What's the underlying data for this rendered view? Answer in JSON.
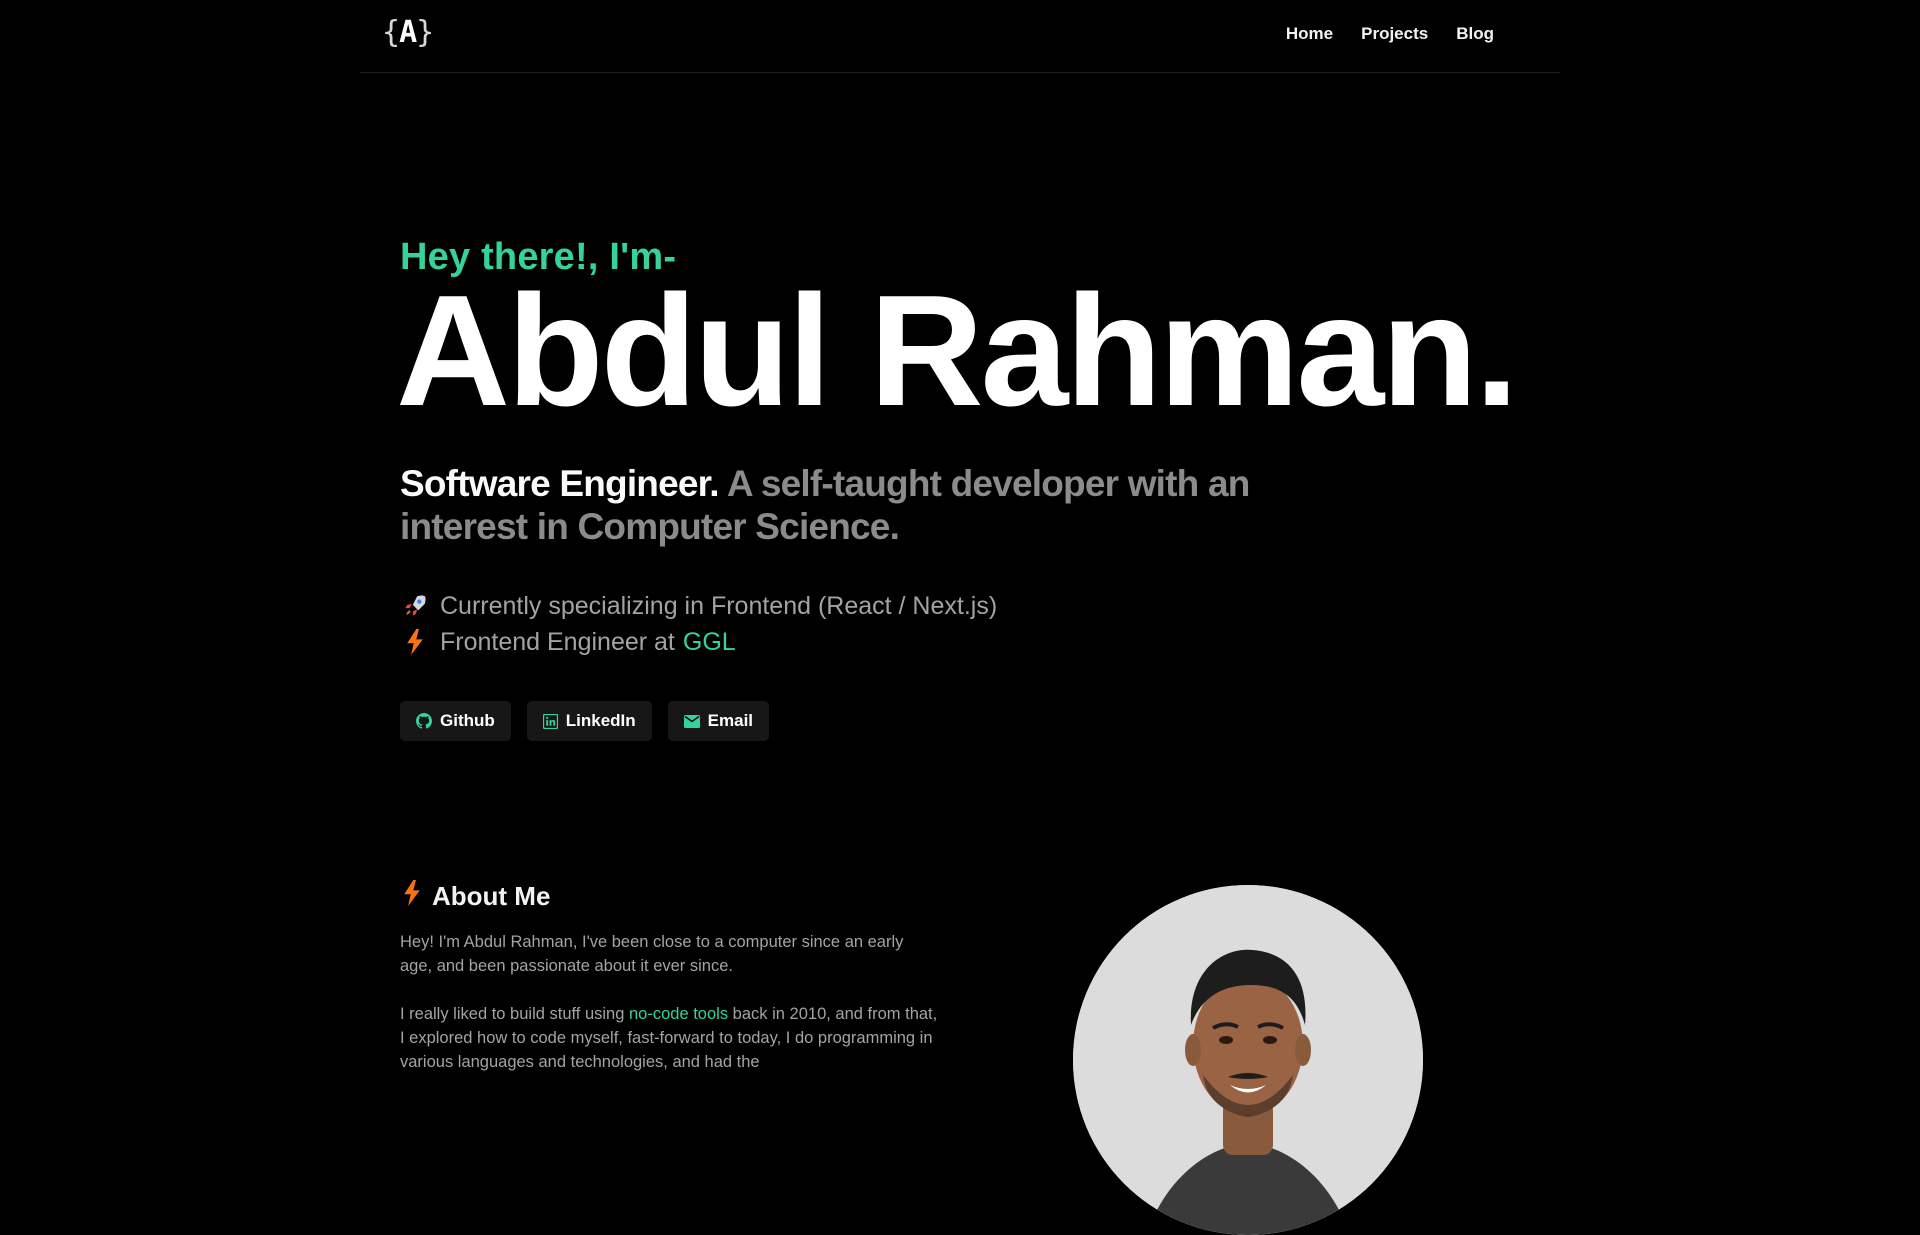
{
  "nav": {
    "logo_left": "{",
    "logo_letter": "A",
    "logo_right": "}",
    "links": [
      "Home",
      "Projects",
      "Blog"
    ]
  },
  "hero": {
    "greeting": "Hey there!, I'm-",
    "name": "Abdul Rahman.",
    "tagline_strong": "Software Engineer.",
    "tagline_muted": "A self-taught developer with an interest in Computer Science.",
    "fact1": "Currently specializing in Frontend (React / Next.js)",
    "fact2_prefix": "Frontend Engineer at",
    "fact2_link": "GGL"
  },
  "socials": {
    "github": "Github",
    "linkedin": "LinkedIn",
    "email": "Email"
  },
  "about": {
    "title": "About Me",
    "p1": "Hey! I'm Abdul Rahman, I've been close to a computer since an early age, and been passionate about it ever since.",
    "p2_before": "I really liked to build stuff using",
    "p2_link": "no-code tools",
    "p2_after": "back in 2010, and from that, I explored how to code myself, fast-forward to today, I do programming in various languages and technologies, and had the"
  },
  "colors": {
    "accent": "#34d399",
    "background": "#000000",
    "muted_text": "#a3a3a3",
    "bolt": "#f97316"
  },
  "icons": {
    "rocket": "rocket-icon",
    "bolt": "bolt-icon",
    "github": "github-icon",
    "linkedin": "linkedin-icon",
    "email": "mail-icon"
  }
}
